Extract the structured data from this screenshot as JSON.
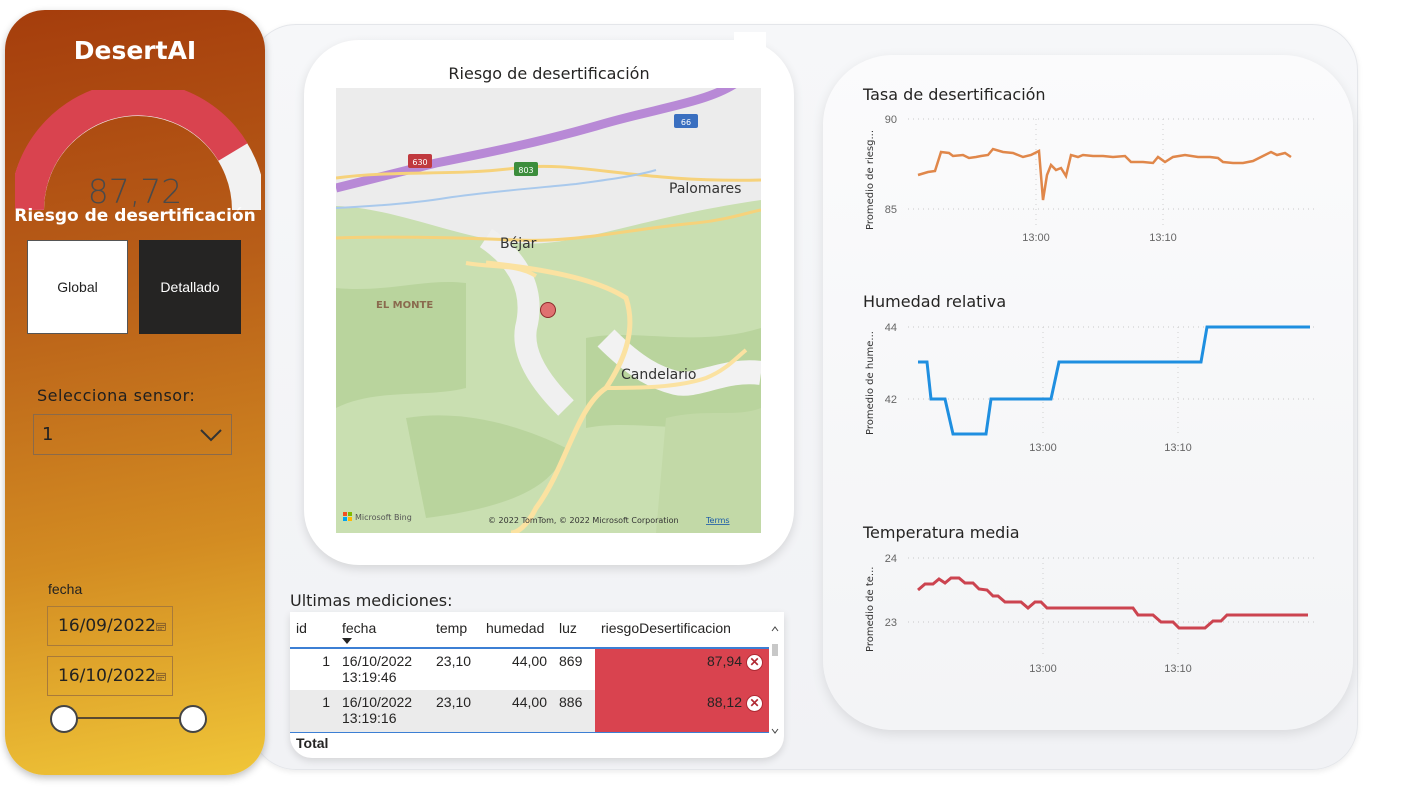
{
  "app": {
    "title": "DesertAI"
  },
  "gauge": {
    "value": "87,72",
    "value_num": 87.72,
    "label": "Riesgo de desertificación",
    "fill_color": "#d9434f"
  },
  "view_buttons": {
    "global": "Global",
    "detailed": "Detallado"
  },
  "sensor": {
    "label": "Selecciona sensor:",
    "selected": "1"
  },
  "date_filter": {
    "label": "fecha",
    "start": "16/09/2022",
    "end": "16/10/2022"
  },
  "map": {
    "title": "Riesgo de desertificación",
    "places": [
      "Palomares",
      "Béjar",
      "EL MONTE",
      "Candelario"
    ],
    "road_shields": [
      "630",
      "803",
      "66"
    ],
    "bing_logo": "Microsoft Bing",
    "copyright": "© 2022 TomTom, © 2022 Microsoft Corporation",
    "terms": "Terms"
  },
  "charts": [
    {
      "id": "tasa",
      "title": "Tasa de desertificación",
      "ylabel": "Promedio de riesg...",
      "yticks": [
        "90",
        "85"
      ],
      "xticks": [
        "13:00",
        "13:10"
      ],
      "color": "#e0874a"
    },
    {
      "id": "humedad",
      "title": "Humedad relativa",
      "ylabel": "Promedio de hume...",
      "yticks": [
        "44",
        "42"
      ],
      "xticks": [
        "13:00",
        "13:10"
      ],
      "color": "#1f8fe0"
    },
    {
      "id": "temp",
      "title": "Temperatura media",
      "ylabel": "Promedio de te...",
      "yticks": [
        "24",
        "23"
      ],
      "xticks": [
        "13:00",
        "13:10"
      ],
      "color": "#cc4450"
    }
  ],
  "table": {
    "title": "Ultimas mediciones:",
    "columns": [
      "id",
      "fecha",
      "temp",
      "humedad",
      "luz",
      "riesgoDesertificacion"
    ],
    "rows": [
      {
        "id": "1",
        "fecha_d": "16/10/2022",
        "fecha_t": "13:19:46",
        "temp": "23,10",
        "humedad": "44,00",
        "luz": "869",
        "riesgo": "87,94"
      },
      {
        "id": "1",
        "fecha_d": "16/10/2022",
        "fecha_t": "13:19:16",
        "temp": "23,10",
        "humedad": "44,00",
        "luz": "886",
        "riesgo": "88,12"
      }
    ],
    "total_label": "Total"
  }
}
